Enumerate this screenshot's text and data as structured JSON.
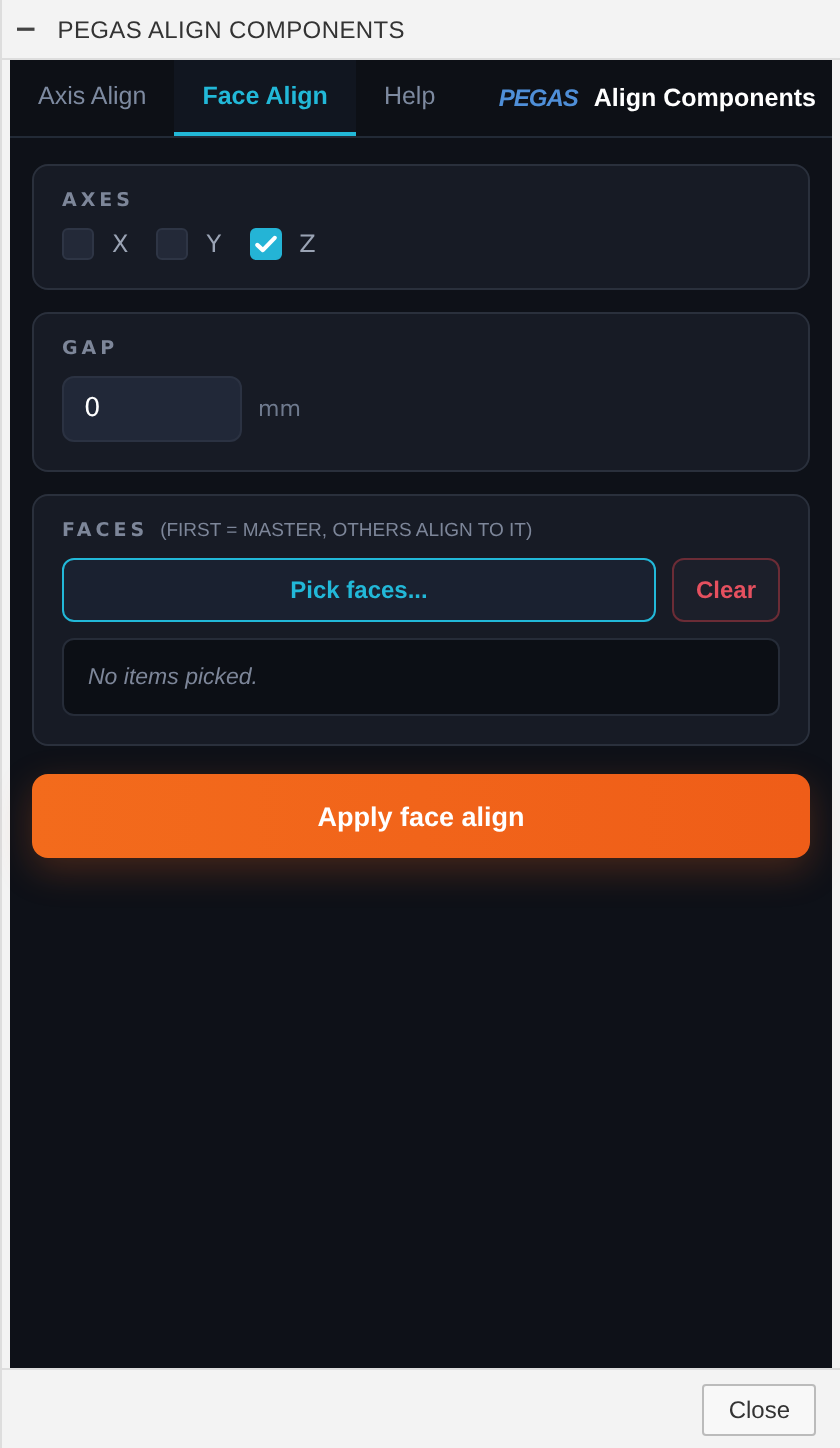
{
  "window": {
    "title": "PEGAS ALIGN COMPONENTS",
    "collapse_glyph": "−"
  },
  "tabs": [
    {
      "label": "Axis Align",
      "selected": false
    },
    {
      "label": "Face Align",
      "selected": true
    },
    {
      "label": "Help",
      "selected": false
    }
  ],
  "brand": {
    "logo_text": "PEGAS",
    "title": "Align Components"
  },
  "axes": {
    "label": "AXES",
    "items": [
      {
        "label": "X",
        "checked": false
      },
      {
        "label": "Y",
        "checked": false
      },
      {
        "label": "Z",
        "checked": true
      }
    ]
  },
  "gap": {
    "label": "GAP",
    "value": "0",
    "unit": "mm"
  },
  "faces": {
    "label": "FACES",
    "hint": "(FIRST = MASTER, OTHERS ALIGN TO IT)",
    "pick_button": "Pick faces...",
    "clear_button": "Clear",
    "empty_text": "No items picked."
  },
  "apply_button": "Apply face align",
  "footer": {
    "close_button": "Close"
  }
}
